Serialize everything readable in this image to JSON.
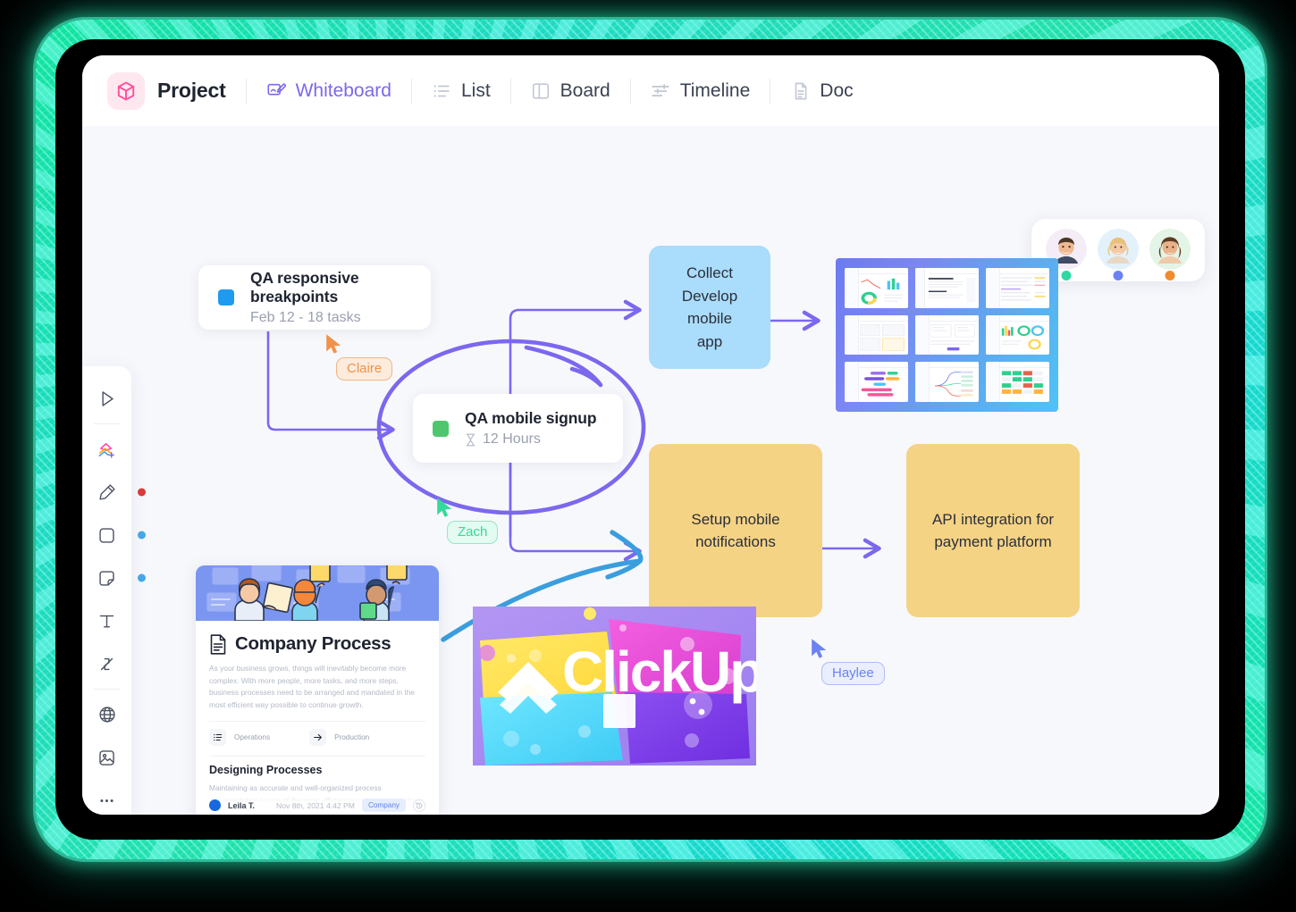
{
  "window": {
    "glow_color": "#17e0a4"
  },
  "header": {
    "brand_title": "Project",
    "brand_icon": "cube-icon",
    "brand_icon_color": "#ff4f9a",
    "tabs": [
      {
        "label": "Whiteboard",
        "icon": "whiteboard-icon",
        "active": true
      },
      {
        "label": "List",
        "icon": "list-icon",
        "active": false
      },
      {
        "label": "Board",
        "icon": "board-icon",
        "active": false
      },
      {
        "label": "Timeline",
        "icon": "timeline-icon",
        "active": false
      },
      {
        "label": "Doc",
        "icon": "doc-icon",
        "active": false
      }
    ],
    "active_color": "#7b68ee"
  },
  "toolbar": {
    "items": [
      {
        "name": "select-cursor-icon",
        "dot": null
      },
      {
        "name": "shapes-add-icon",
        "dot": null
      },
      {
        "name": "pen-highlighter-icon",
        "dot": "#d93a3a"
      },
      {
        "name": "rectangle-icon",
        "dot": "#45a7e8"
      },
      {
        "name": "sticky-note-icon",
        "dot": "#45a7e8"
      },
      {
        "name": "text-icon",
        "dot": null
      },
      {
        "name": "connector-icon",
        "dot": null
      },
      {
        "name": "globe-icon",
        "dot": null
      },
      {
        "name": "image-icon",
        "dot": null
      },
      {
        "name": "more-options-icon",
        "dot": null
      }
    ]
  },
  "collaborators": [
    {
      "name": "avatar-1",
      "status_color": "#2fd9a3"
    },
    {
      "name": "avatar-2",
      "status_color": "#6b82f0"
    },
    {
      "name": "avatar-3",
      "status_color": "#f08c2e"
    }
  ],
  "cards": {
    "qa_responsive": {
      "title": "QA responsive breakpoints",
      "subtitle": "Feb 12 - 18 tasks",
      "swatch_color": "#1e9bf0"
    },
    "qa_mobile": {
      "title": "QA mobile signup",
      "subtitle": "12 Hours",
      "subtitle_icon": "hourglass-icon",
      "swatch_color": "#4fc66e"
    }
  },
  "nodes": [
    {
      "id": "collect-develop",
      "text": "Collect\nDevelop mobile\napp",
      "color": "#aadcfb"
    },
    {
      "id": "setup-notifications",
      "text": "Setup mobile\nnotifications",
      "color": "#f5d384"
    },
    {
      "id": "api-integration",
      "text": "API integration for\npayment platform",
      "color": "#f5d384"
    }
  ],
  "cursors": [
    {
      "name": "Claire",
      "color": "#f0924a",
      "bg": "#fdebdd",
      "border": "#f0b486"
    },
    {
      "name": "Zach",
      "color": "#34d99b",
      "bg": "#e3fbf1",
      "border": "#8fe9c6"
    },
    {
      "name": "Haylee",
      "color": "#6b82f0",
      "bg": "#eaeefd",
      "border": "#b0bdf6"
    }
  ],
  "doc_card": {
    "title": "Company Process",
    "icon": "document-icon",
    "paragraph": "As your business grows, things will inevitably become more complex. With more people, more tasks, and more steps, business processes need to be arranged and mandated in the most efficient way possible to continue growth.",
    "columns": [
      {
        "label": "Operations",
        "icon": "list-icon"
      },
      {
        "label": "Production",
        "icon": "arrow-right-icon"
      }
    ],
    "section_heading": "Designing Processes",
    "section_paragraph": "Maintaining as accurate and well-organized process documentation is one of the most efficient ways to prevent chaos and keep things",
    "author": "Leila T.",
    "timestamp": "Nov 8th, 2021  4:42 PM",
    "badge": "Company"
  },
  "embeds": {
    "dashboard_image": "clickup-dashboards-grid",
    "clickup_image": "clickup-3d-logo-tiles",
    "clickup_wordmark": "ClickUp"
  },
  "connectors": {
    "line_color": "#7b68ee",
    "sketch_color": "#3a9ede"
  }
}
